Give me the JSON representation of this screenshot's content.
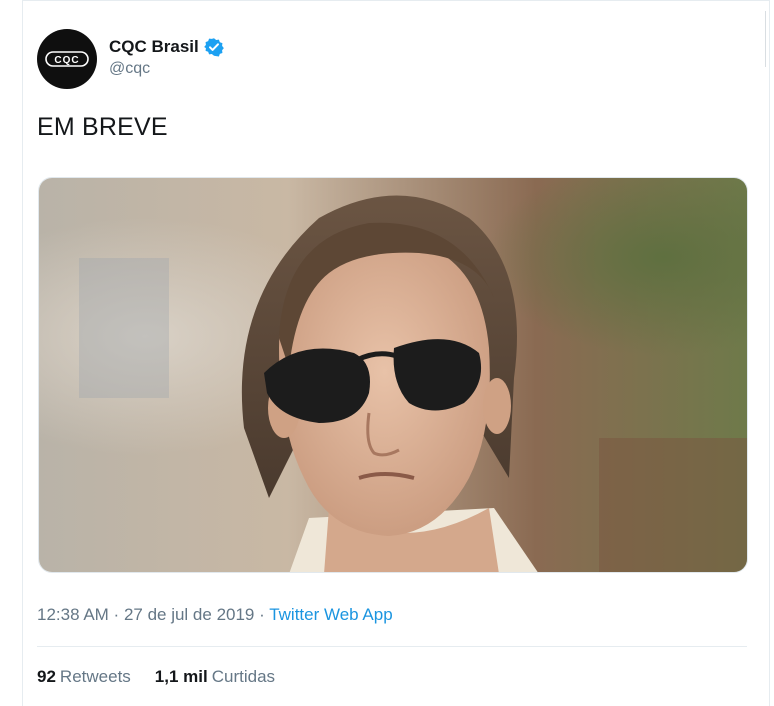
{
  "tweet": {
    "author": {
      "display_name": "CQC Brasil",
      "handle": "@cqc",
      "avatar_text": "CQC",
      "verified_icon": "verified-badge-icon"
    },
    "text": "EM BREVE",
    "media": {
      "alt_icon": "photo-icon"
    },
    "time": "12:38 AM",
    "separator1": " · ",
    "date": "27 de jul de 2019",
    "separator2": " · ",
    "source": "Twitter Web App",
    "retweets": {
      "count": "92",
      "label": "Retweets"
    },
    "likes": {
      "count": "1,1 mil",
      "label": "Curtidas"
    }
  },
  "colors": {
    "link": "#1b95e0",
    "secondary": "#657786",
    "primary_text": "#14171a",
    "verified": "#1da1f2"
  }
}
